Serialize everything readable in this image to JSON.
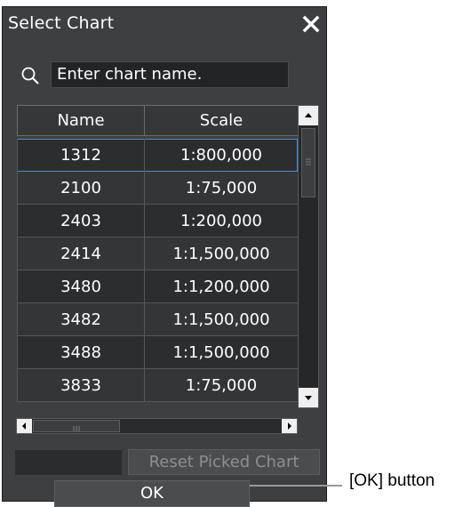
{
  "dialog": {
    "title": "Select Chart",
    "search_placeholder": "Enter chart name.",
    "columns": [
      "Name",
      "Scale"
    ],
    "rows": [
      {
        "name": "1312",
        "scale": "1:800,000"
      },
      {
        "name": "2100",
        "scale": "1:75,000"
      },
      {
        "name": "2403",
        "scale": "1:200,000"
      },
      {
        "name": "2414",
        "scale": "1:1,500,000"
      },
      {
        "name": "3480",
        "scale": "1:1,200,000"
      },
      {
        "name": "3482",
        "scale": "1:1,500,000"
      },
      {
        "name": "3488",
        "scale": "1:1,500,000"
      },
      {
        "name": "3833",
        "scale": "1:75,000"
      }
    ],
    "reset_label": "Reset Picked Chart",
    "ok_label": "OK"
  },
  "annotation": {
    "ok_callout": "[OK] button"
  }
}
